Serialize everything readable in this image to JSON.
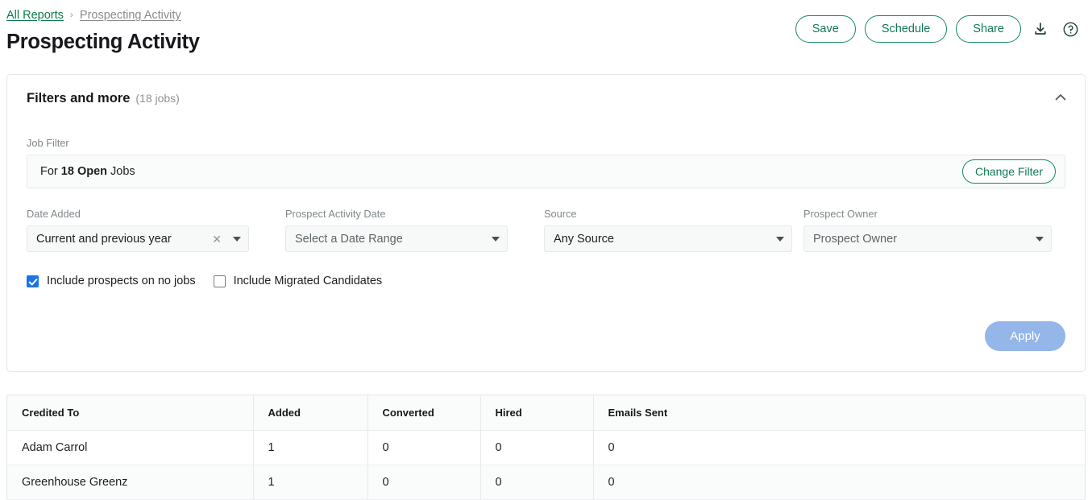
{
  "breadcrumb": {
    "parent": "All Reports",
    "separator": "›",
    "current": "Prospecting Activity"
  },
  "header": {
    "title": "Prospecting Activity",
    "actions": {
      "save_label": "Save",
      "schedule_label": "Schedule",
      "share_label": "Share",
      "download_icon": "download-icon",
      "help_icon": "help-circle-icon"
    }
  },
  "filters_card": {
    "title": "Filters and more",
    "subtitle": "(18 jobs)",
    "collapse_icon": "chevron-up-icon",
    "job_filter": {
      "label": "Job Filter",
      "text_prefix": "For ",
      "text_strong": "18 Open",
      "text_suffix": " Jobs",
      "change_button_label": "Change Filter"
    },
    "fields": [
      {
        "label": "Date Added",
        "value": "Current and previous year",
        "has_clear": true,
        "clear_icon": "close-icon",
        "caret_icon": "chevron-down-icon"
      },
      {
        "label": "Prospect Activity Date",
        "value": "Select a Date Range",
        "has_clear": false,
        "caret_icon": "chevron-down-icon"
      },
      {
        "label": "Source",
        "value": "Any Source",
        "has_clear": false,
        "caret_icon": "chevron-down-icon"
      },
      {
        "label": "Prospect Owner",
        "value": "Prospect Owner",
        "has_clear": false,
        "caret_icon": "chevron-down-icon"
      }
    ],
    "checkboxes": [
      {
        "label": "Include prospects on no jobs",
        "checked": true
      },
      {
        "label": "Include Migrated Candidates",
        "checked": false
      }
    ],
    "apply_label": "Apply"
  },
  "table": {
    "columns": [
      "Credited To",
      "Added",
      "Converted",
      "Hired",
      "Emails Sent"
    ],
    "rows": [
      {
        "credited_to": "Adam Carrol",
        "added": "1",
        "converted": "0",
        "hired": "0",
        "emails_sent": "0"
      },
      {
        "credited_to": "Greenhouse Greenz",
        "added": "1",
        "converted": "0",
        "hired": "0",
        "emails_sent": "0"
      }
    ]
  },
  "colors": {
    "accent_green": "#0f7a51",
    "link_green": "#0a7c4a",
    "checkbox_blue": "#1a73e8",
    "apply_disabled_blue": "#94b6e8"
  }
}
